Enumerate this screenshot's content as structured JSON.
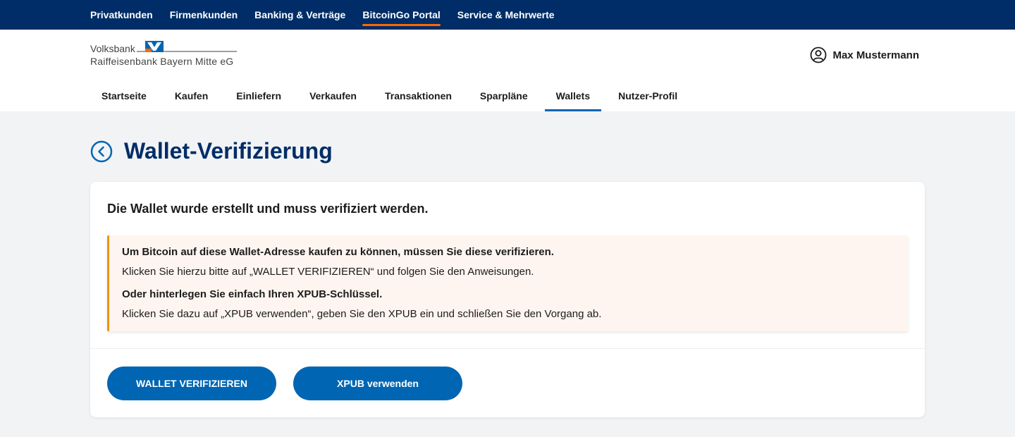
{
  "top_nav": {
    "items": [
      "Privatkunden",
      "Firmenkunden",
      "Banking & Verträge",
      "BitcoinGo Portal",
      "Service & Mehrwerte"
    ],
    "active": "BitcoinGo Portal"
  },
  "logo": {
    "line1": "Volksbank",
    "line2": "Raiffeisenbank Bayern Mitte eG",
    "icon": "volksbank-logo-icon"
  },
  "user": {
    "name": "Max Mustermann",
    "icon": "user-circle-icon"
  },
  "sub_nav": {
    "items": [
      "Startseite",
      "Kaufen",
      "Einliefern",
      "Verkaufen",
      "Transaktionen",
      "Sparpläne",
      "Wallets",
      "Nutzer-Profil"
    ],
    "active": "Wallets"
  },
  "page": {
    "title": "Wallet-Verifizierung",
    "back_icon": "chevron-left-circle-icon"
  },
  "card": {
    "heading": "Die Wallet wurde erstellt und muss verifiziert werden.",
    "notice": {
      "line1": "Um Bitcoin auf diese Wallet-Adresse kaufen zu können, müssen Sie diese verifizieren.",
      "line2": "Klicken Sie hierzu bitte auf „WALLET VERIFIZIEREN“ und folgen Sie den Anweisungen.",
      "line3": "Oder hinterlegen Sie einfach Ihren XPUB-Schlüssel.",
      "line4": "Klicken Sie dazu auf „XPUB verwenden“, geben Sie den XPUB ein und schließen Sie den Vorgang ab."
    },
    "buttons": {
      "verify": "WALLET VERIFIZIEREN",
      "xpub": "XPUB verwenden"
    }
  },
  "colors": {
    "primary_dark": "#002d67",
    "primary": "#0066b3",
    "accent_orange": "#ff6600",
    "notice_border": "#f29400",
    "notice_bg": "#fff5f0"
  }
}
